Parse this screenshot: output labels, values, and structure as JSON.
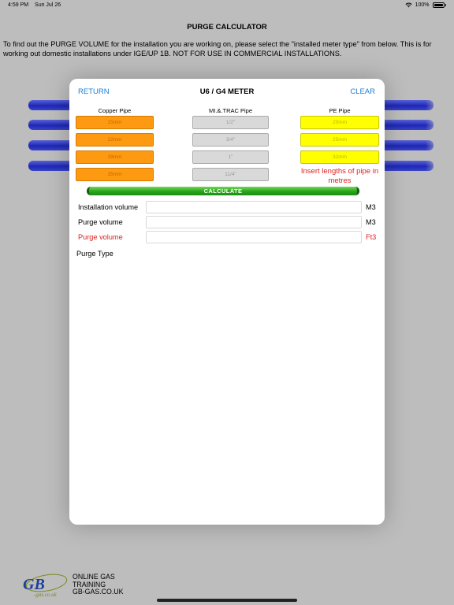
{
  "status_bar": {
    "time": "4:59 PM",
    "date": "Sun Jul 26",
    "battery": "100%"
  },
  "page": {
    "title": "PURGE CALCULATOR",
    "intro": "To find out the PURGE VOLUME for the installation you are working on, please select the \"installed meter type\" from below. This is for working out domestic installations under IGE/UP 1B. NOT FOR USE IN COMMERCIAL INSTALLATIONS."
  },
  "modal": {
    "title": "U6 / G4 METER",
    "return_label": "RETURN",
    "clear_label": "CLEAR",
    "columns": {
      "copper": {
        "header": "Copper Pipe",
        "placeholders": [
          "15mm",
          "22mm",
          "28mm",
          "35mm"
        ]
      },
      "mi": {
        "header": "MI.&.TRAC Pipe",
        "placeholders": [
          "1/2\"",
          "3/4\"",
          "1\"",
          "11/4\""
        ]
      },
      "pe": {
        "header": "PE Pipe",
        "placeholders": [
          "20mm",
          "25mm",
          "32mm"
        ],
        "note": "Insert lengths of pipe in metres"
      }
    },
    "calculate_label": "CALCULATE",
    "results": [
      {
        "label": "Installation volume",
        "value": "",
        "unit": "M3"
      },
      {
        "label": "Purge volume",
        "value": "",
        "unit": "M3"
      },
      {
        "label": "Purge volume",
        "value": "",
        "unit": "Ft3"
      }
    ],
    "purge_type_label": "Purge Type"
  },
  "footer": {
    "line1": "ONLINE GAS",
    "line2": "TRAINING",
    "line3": "GB-GAS.CO.UK",
    "logo_text": "GB",
    "logo_sub": "gas.co.uk"
  },
  "colors": {
    "accent_link": "#1a7fd6",
    "copper": "#fe9a12",
    "mi": "#d9d9d9",
    "pe": "#ffff00",
    "calculate": "#2aa31a",
    "warning_red": "#e02020",
    "background_bar_blue": "#1d27b5"
  }
}
